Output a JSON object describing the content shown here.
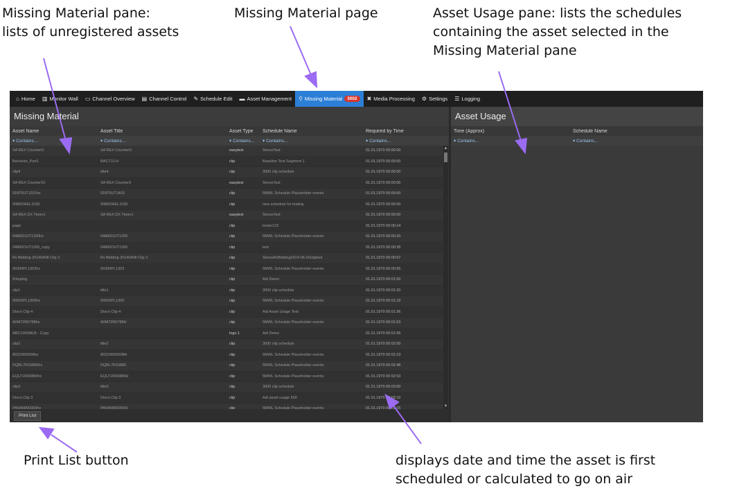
{
  "callouts": {
    "missing_pane": [
      "Missing Material pane:",
      "lists of unregistered assets"
    ],
    "missing_page": [
      "Missing Material page"
    ],
    "asset_usage": [
      "Asset Usage pane: lists the schedules",
      "containing the asset selected in the",
      "Missing Material pane"
    ],
    "print_list": [
      "Print List button"
    ],
    "required_time": [
      "displays date and time the asset is first",
      "scheduled or calculated to go on air"
    ]
  },
  "nav": [
    {
      "icon": "home-icon",
      "glyph": "⌂",
      "label": "Home"
    },
    {
      "icon": "monitor-wall-icon",
      "glyph": "▥",
      "label": "Monitor Wall"
    },
    {
      "icon": "channel-overview-icon",
      "glyph": "▭",
      "label": "Channel Overview"
    },
    {
      "icon": "channel-control-icon",
      "glyph": "▤",
      "label": "Channel Control"
    },
    {
      "icon": "schedule-edit-icon",
      "glyph": "✎",
      "label": "Schedule Edit"
    },
    {
      "icon": "folder-icon",
      "glyph": "▬",
      "label": "Asset Management"
    },
    {
      "icon": "search-icon",
      "glyph": "⚲",
      "label": "Missing Material",
      "badge": "3002",
      "active": true
    },
    {
      "icon": "media-processing-icon",
      "glyph": "✖",
      "label": "Media Processing"
    },
    {
      "icon": "gear-icon",
      "glyph": "⚙",
      "label": "Settings"
    },
    {
      "icon": "logging-icon",
      "glyph": "☰",
      "label": "Logging"
    }
  ],
  "missing": {
    "title": "Missing Material",
    "columns": [
      "Asset Name",
      "Asset Title",
      "Asset Type",
      "Schedule Name",
      "Required by Time"
    ],
    "filter": "Contains...",
    "print_label": "Print List",
    "rows": [
      [
        "SA REX Countert1",
        "SA REX Countert1",
        "easytext",
        "StressTest",
        "01.01.1970 00:00:00"
      ],
      [
        "Bachelor_Part1",
        "BACT11-H",
        "clip",
        "Baseline Test Segment 1",
        "01.01.1970 00:00:00"
      ],
      [
        "clip4",
        "title4",
        "clip",
        "3000 clip schedule",
        "01.01.1970 00:00:00"
      ],
      [
        "SA REX Counter10",
        "SA REX Counter9",
        "easytext",
        "StressTest",
        "01.01.1970 00:00:00"
      ],
      [
        "01870UT1201hx",
        "01870UT1403",
        "clip",
        "5MWL Schedule Placeholder events",
        "01.01.1970 00:00:00"
      ],
      [
        "00850WEL1030",
        "00850WEL1030",
        "clip",
        "new schedule for testing",
        "01.01.1970 00:00:00"
      ],
      [
        "SA REX DX Timer1",
        "SA REX DX Timer1",
        "easytext",
        "StressTest",
        "01.01.1970 00:00:00"
      ],
      [
        "page",
        "",
        "clip",
        "tester123",
        "01.01.1970 00:00:14"
      ],
      [
        "04860OUT1200hx",
        "04860OUT1200",
        "clip",
        "5MWL Schedule Placeholder events",
        "01.01.1970 00:00:20"
      ],
      [
        "04860OUT1200_copy",
        "04860OUT1200",
        "clip",
        "test",
        "01.01.1970 00:00:35"
      ],
      [
        "Rx Bidding 20140408 Clip 2",
        "Rx Bidding 20140408 Clip 2",
        "clip",
        "StressRxBidding2014-06-20clipbed",
        "01.01.1970 00:00:57"
      ],
      [
        "00390PL1302hx",
        "00390PL1303",
        "clip",
        "5MWL Schedule Placeholder events",
        "01.01.1970 00:00:55"
      ],
      [
        "2ntuping",
        "",
        "clip",
        "Adi Demo",
        "01.01.1970 00:01:00"
      ],
      [
        "clip1",
        "title1",
        "clip",
        "3000 clip schedule",
        "01.01.1970 00:01:20"
      ],
      [
        "00650PL1300hx",
        "00650PL1300",
        "clip",
        "5MWL Schedule Placeholder events",
        "01.01.1970 00:01:19"
      ],
      [
        "Disco Clip 4",
        "Disco Clip 4",
        "clip",
        "Adi Asset Usage Test",
        "01.01.1970 00:01:36"
      ],
      [
        "A0M72R0788hx",
        "A0M72R0788H",
        "clip",
        "5MWL Schedule Placeholder events",
        "01.01.1970 00:01:53"
      ],
      [
        "ABC1000MLB - Copy",
        "",
        "logo 1",
        "Adi Demo",
        "01.01.1970 00:01:55"
      ],
      [
        "clip2",
        "title2",
        "clip",
        "3000 clip schedule",
        "01.01.1970 00:02:00"
      ],
      [
        "8031R00008hx",
        "8031R000008H",
        "clip",
        "5MWL Schedule Placeholder events",
        "01.01.1970 00:02:23"
      ],
      [
        "DQBL7R15880hx",
        "DQBL7R15880",
        "clip",
        "5MWL Schedule Placeholder events",
        "01.01.1970 00:02:48"
      ],
      [
        "EQU72000880hx",
        "EQU72000880H",
        "clip",
        "5MWL Schedule Placeholder events",
        "01.01.1970 00:02:53"
      ],
      [
        "clip3",
        "title3",
        "clip",
        "3000 clip schedule",
        "01.01.1970 00:03:00"
      ],
      [
        "Disco Clip 3",
        "Disco Clip 3",
        "clip",
        "Adi asset usage 500",
        "01.01.1970 00:03:10"
      ],
      [
        "PAN40800000hx",
        "PAN40800000H",
        "clip",
        "5MWL Schedule Placeholder events",
        "01.01.1970 00:03:25"
      ]
    ]
  },
  "usage": {
    "title": "Asset Usage",
    "columns": [
      "Time (Approx)",
      "Schedule Name"
    ],
    "filter": "Contains..."
  }
}
